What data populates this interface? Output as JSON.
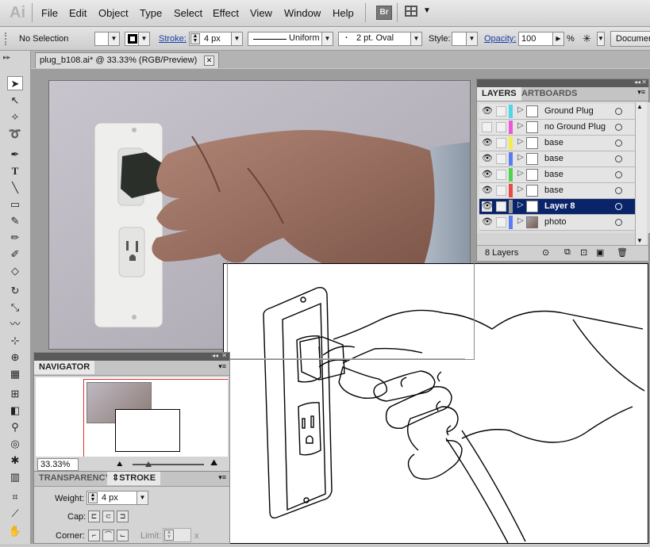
{
  "app": {
    "logo": "Ai"
  },
  "menu": {
    "items": [
      {
        "label": "File"
      },
      {
        "label": "Edit"
      },
      {
        "label": "Object"
      },
      {
        "label": "Type"
      },
      {
        "label": "Select"
      },
      {
        "label": "Effect"
      },
      {
        "label": "View"
      },
      {
        "label": "Window"
      },
      {
        "label": "Help"
      }
    ],
    "bridge_badge": "Br"
  },
  "control": {
    "selection_status": "No Selection",
    "stroke_label": "Stroke:",
    "stroke_weight": "4 px",
    "stroke_profile": "Uniform",
    "brush": "2 pt. Oval",
    "brush_dot": "·",
    "style_label": "Style:",
    "opacity_label": "Opacity:",
    "opacity_value": "100",
    "opacity_unit": "%",
    "document_button": "Documen"
  },
  "document": {
    "tab_title": "plug_b108.ai* @ 33.33% (RGB/Preview)",
    "close_glyph": "✕"
  },
  "layers": {
    "tabs": [
      "LAYERS",
      "ARTBOARDS"
    ],
    "rows": [
      {
        "name": "Ground Plug",
        "color": "#4fd6e8",
        "visible": true,
        "selected": false
      },
      {
        "name": "no Ground Plug",
        "color": "#e85ad8",
        "visible": false,
        "selected": false
      },
      {
        "name": "base",
        "color": "#f2ec4a",
        "visible": true,
        "selected": false
      },
      {
        "name": "base",
        "color": "#5a7cf0",
        "visible": true,
        "selected": false
      },
      {
        "name": "base",
        "color": "#4fd24f",
        "visible": true,
        "selected": false
      },
      {
        "name": "base",
        "color": "#e84a4a",
        "visible": true,
        "selected": false
      },
      {
        "name": "Layer 8",
        "color": "#9a9a9a",
        "visible": true,
        "selected": true
      },
      {
        "name": "photo",
        "color": "#5a7cf0",
        "visible": true,
        "selected": false
      }
    ],
    "count": "8 Layers"
  },
  "navigator": {
    "title": "NAVIGATOR",
    "zoom": "33.33%"
  },
  "stroke_panel": {
    "tabs": [
      "TRANSPARENCY",
      "STROKE"
    ],
    "weight_label": "Weight:",
    "weight_value": "4 px",
    "cap_label": "Cap:",
    "corner_label": "Corner:",
    "limit_label": "Limit:",
    "limit_unit": "x"
  },
  "colors": {
    "selected_layer_bg": "#0a246a",
    "link_blue": "#1a3ea8",
    "nav_view_box": "#e03030"
  }
}
